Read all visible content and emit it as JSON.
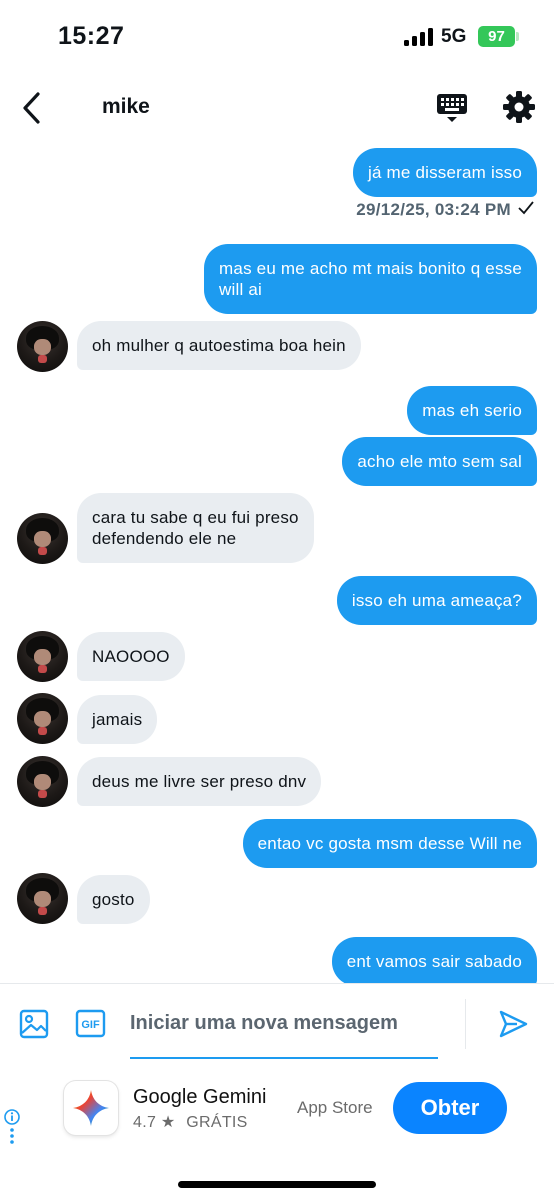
{
  "status_bar": {
    "time": "15:27",
    "network": "5G",
    "battery": "97"
  },
  "header": {
    "back_icon": "chevron-left-icon",
    "title": "mike",
    "keyboard_icon": "keyboard-icon",
    "settings_icon": "gear-icon"
  },
  "messages": [
    {
      "type": "sent",
      "text": "já me disseram isso"
    },
    {
      "type": "timestamp",
      "text": "29/12/25, 03:24 PM",
      "status_icon": "check-icon"
    },
    {
      "type": "sent",
      "text": "mas eu me acho mt mais bonito q esse\nwill ai"
    },
    {
      "type": "received",
      "text": "oh mulher q autoestima boa hein"
    },
    {
      "type": "sent",
      "text": "mas eh serio"
    },
    {
      "type": "sent",
      "text": "acho ele mto sem sal"
    },
    {
      "type": "received",
      "text": "cara tu sabe q eu fui preso\ndefendendo ele ne"
    },
    {
      "type": "sent",
      "text": "isso eh uma ameaça?"
    },
    {
      "type": "received",
      "text": "NAOOOO"
    },
    {
      "type": "received",
      "text": "jamais"
    },
    {
      "type": "received",
      "text": "deus me livre ser preso dnv"
    },
    {
      "type": "sent",
      "text": "entao vc gosta msm desse Will ne"
    },
    {
      "type": "received",
      "text": "gosto"
    },
    {
      "type": "sent",
      "text": "ent vamos sair sabado"
    }
  ],
  "composer": {
    "image_icon": "image-icon",
    "gif_label": "GIF",
    "placeholder": "Iniciar uma nova mensagem",
    "value": "",
    "send_icon": "send-icon"
  },
  "ad": {
    "app_name": "Google Gemini",
    "rating": "4.7 ★",
    "price": "GRÁTIS",
    "store": "App Store",
    "cta": "Obter",
    "info_icon": "info-icon"
  },
  "colors": {
    "accent": "#1d9bf0",
    "received_bubble": "#e9edf1",
    "battery": "#34c759",
    "cta": "#0a84ff"
  }
}
